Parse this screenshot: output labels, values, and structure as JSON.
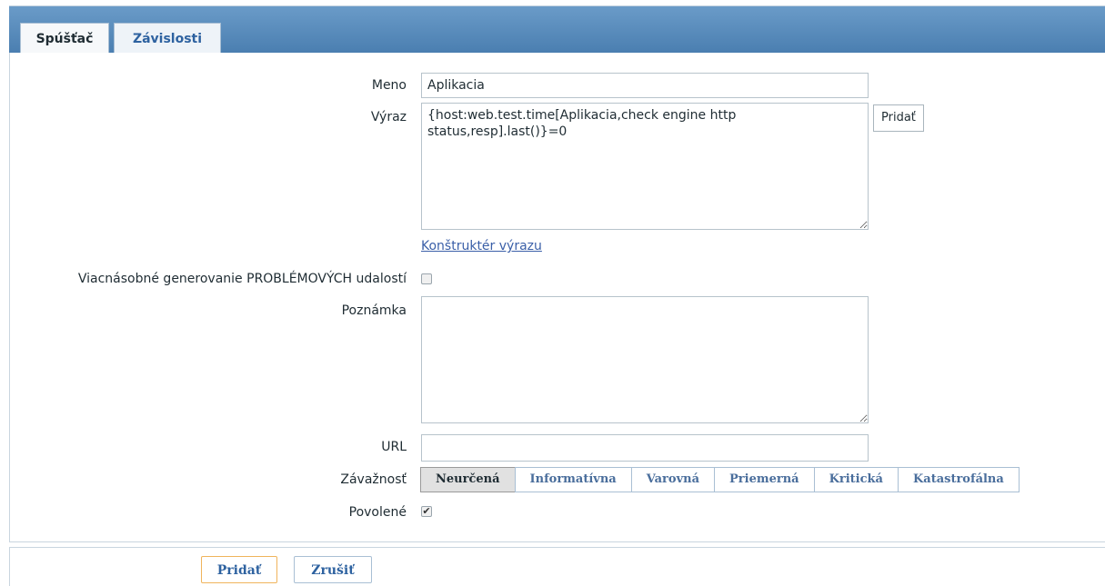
{
  "tabs": [
    {
      "label": "Spúšťač",
      "active": true
    },
    {
      "label": "Závislosti",
      "active": false
    }
  ],
  "form": {
    "name": {
      "label": "Meno",
      "value": "Aplikacia"
    },
    "expression": {
      "label": "Výraz",
      "value": "{host:web.test.time[Aplikacia,check engine http status,resp].last()}=0",
      "add_label": "Pridať"
    },
    "expression_builder": "Konštruktér výrazu",
    "multiple_events": {
      "label": "Viacnásobné generovanie PROBLÉMOVÝCH udalostí",
      "checked": false
    },
    "note": {
      "label": "Poznámka",
      "value": ""
    },
    "url": {
      "label": "URL",
      "value": ""
    },
    "severity": {
      "label": "Závažnosť",
      "options": [
        "Neurčená",
        "Informatívna",
        "Varovná",
        "Priemerná",
        "Kritická",
        "Katastrofálna"
      ],
      "selected": "Neurčená"
    },
    "enabled": {
      "label": "Povolené",
      "checked": true,
      "check_glyph": "✔"
    }
  },
  "actions": {
    "add": "Pridať",
    "cancel": "Zrušiť"
  },
  "colors": {
    "tab_bar": "#4a7eb0",
    "link": "#3a5fa8",
    "primary_border": "#f0b45c"
  }
}
